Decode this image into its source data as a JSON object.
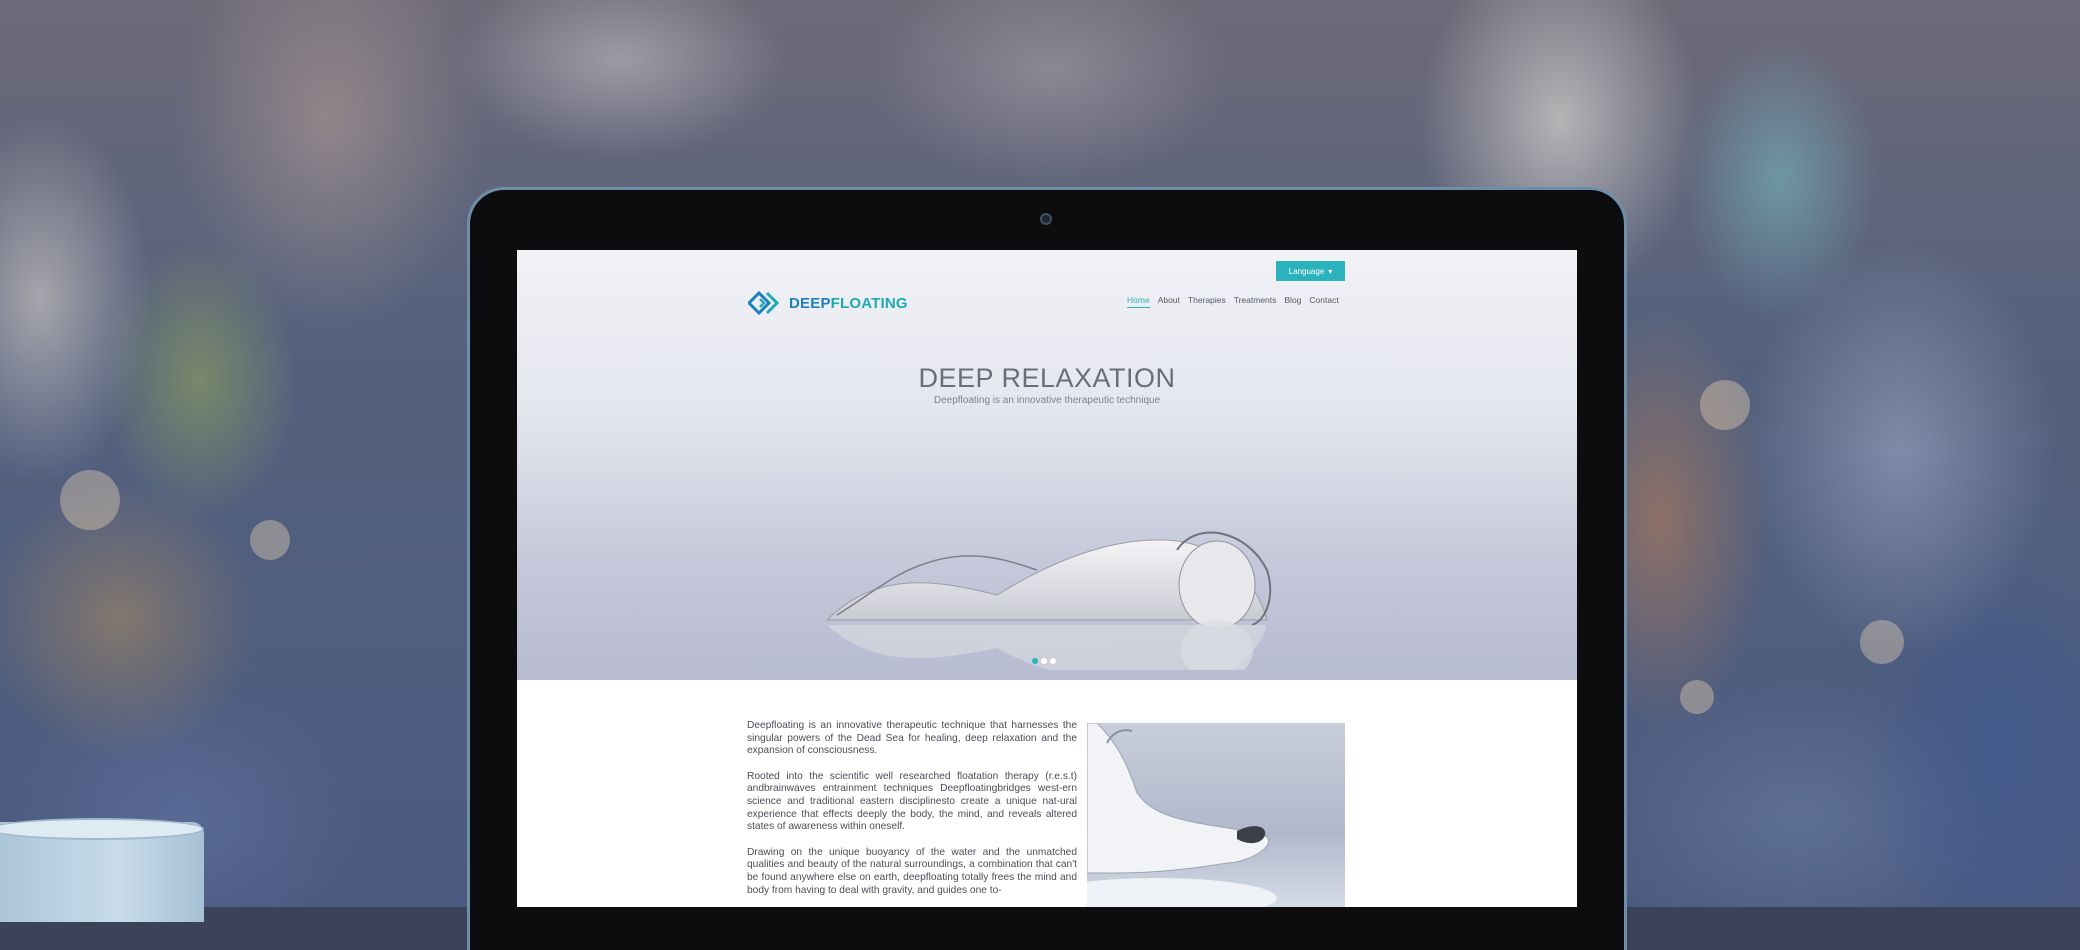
{
  "site": {
    "logo": {
      "part1": "DEEP",
      "part2": "FLOATING"
    },
    "language_button": "Language",
    "nav": [
      {
        "label": "Home",
        "active": true
      },
      {
        "label": "About",
        "active": false
      },
      {
        "label": "Therapies",
        "active": false
      },
      {
        "label": "Treatments",
        "active": false
      },
      {
        "label": "Blog",
        "active": false
      },
      {
        "label": "Contact",
        "active": false
      }
    ],
    "hero": {
      "title": "DEEP RELAXATION",
      "subtitle": "Deepfloating is an innovative therapeutic technique",
      "slides_total": 3,
      "slide_active": 1
    },
    "content": {
      "paragraphs": [
        "Deepfloating is an innovative therapeutic technique that harnesses the singular powers of the Dead Sea for healing, deep relaxation and the expansion of consciousness.",
        "Rooted into the scientific well researched floatation therapy (r.e.s.t) andbrainwaves entrainment techniques Deepfloatingbridges west-ern science and traditional eastern disciplinesto create a unique nat-ural experience that effects deeply the body, the mind, and reveals altered states of awareness within oneself.",
        "Drawing on the unique buoyancy of the water and the unmatched qualities and beauty of the natural surroundings, a combination that can't be found anywhere else on earth, deepfloating totally frees the mind and body from having to deal with gravity, and guides one to-"
      ]
    },
    "colors": {
      "accent": "#2bb3bd",
      "logo_blue": "#1d7fbf",
      "logo_teal": "#1ea9b3"
    }
  }
}
